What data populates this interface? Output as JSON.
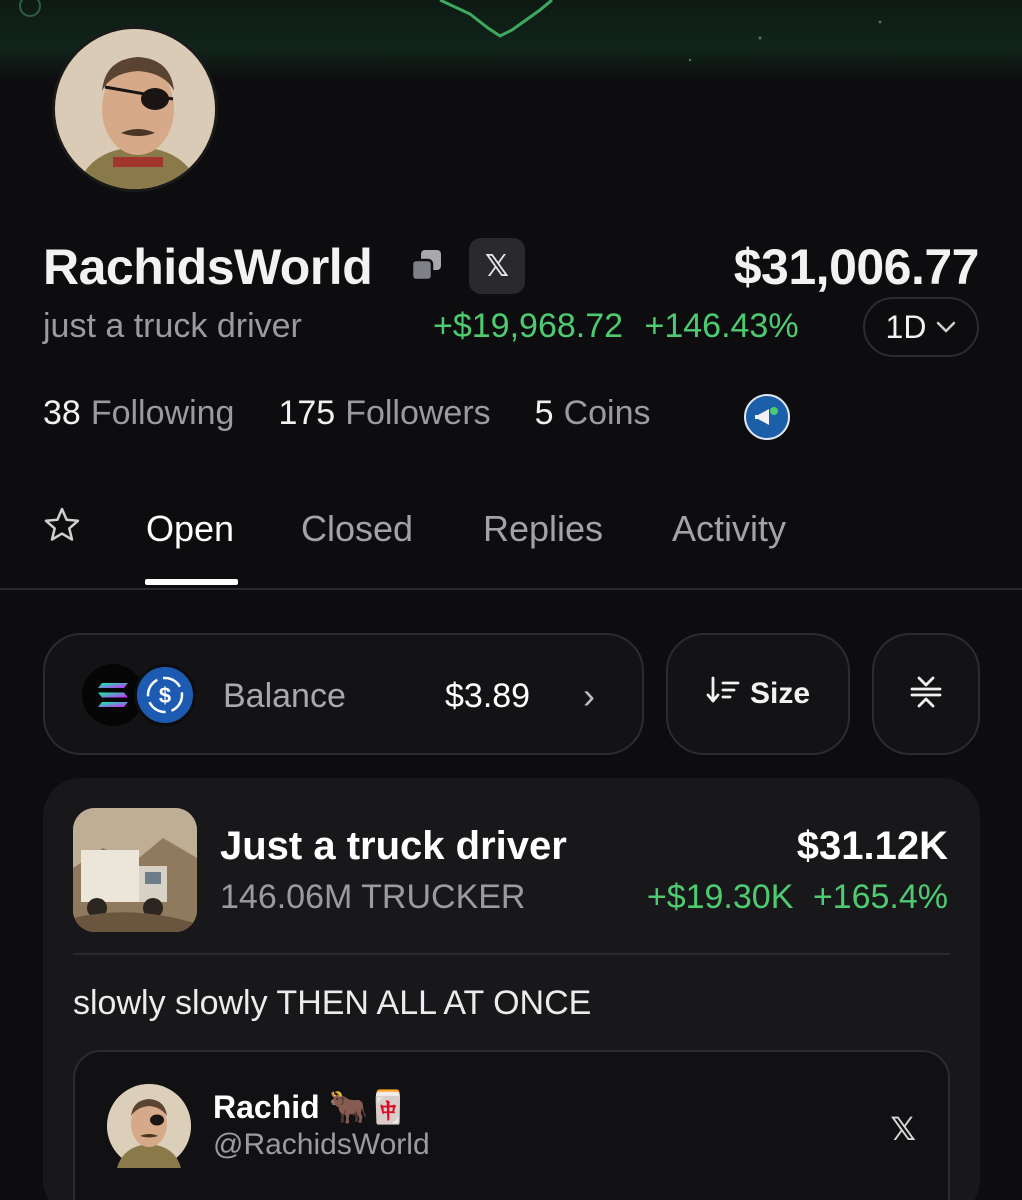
{
  "profile": {
    "username": "RachidsWorld",
    "bio": "just a truck driver",
    "net_worth": "$31,006.77",
    "pnl_amount": "+$19,968.72",
    "pnl_percent": "+146.43%",
    "period": "1D",
    "x_icon": "𝕏",
    "stats": {
      "following_count": "38",
      "following_label": "Following",
      "followers_count": "175",
      "followers_label": "Followers",
      "coins_count": "5",
      "coins_label": "Coins"
    }
  },
  "tabs": [
    "Open",
    "Closed",
    "Replies",
    "Activity"
  ],
  "active_tab": "Open",
  "balance": {
    "label": "Balance",
    "value": "$3.89",
    "chevron": "›"
  },
  "sort": {
    "label": "Size"
  },
  "holding": {
    "name": "Just a truck driver",
    "quantity": "146.06M TRUCKER",
    "value": "$31.12K",
    "pnl_amount": "+$19.30K",
    "pnl_percent": "+165.4%",
    "post_text": "slowly slowly THEN ALL AT ONCE"
  },
  "tweet": {
    "name": "Rachid",
    "emoji": "🐂🀄",
    "handle": "@RachidsWorld",
    "x_icon": "𝕏"
  },
  "colors": {
    "background": "#0d0d0f",
    "positive": "#4ecb71",
    "muted": "#9a9aa0",
    "card": "#18181b"
  }
}
